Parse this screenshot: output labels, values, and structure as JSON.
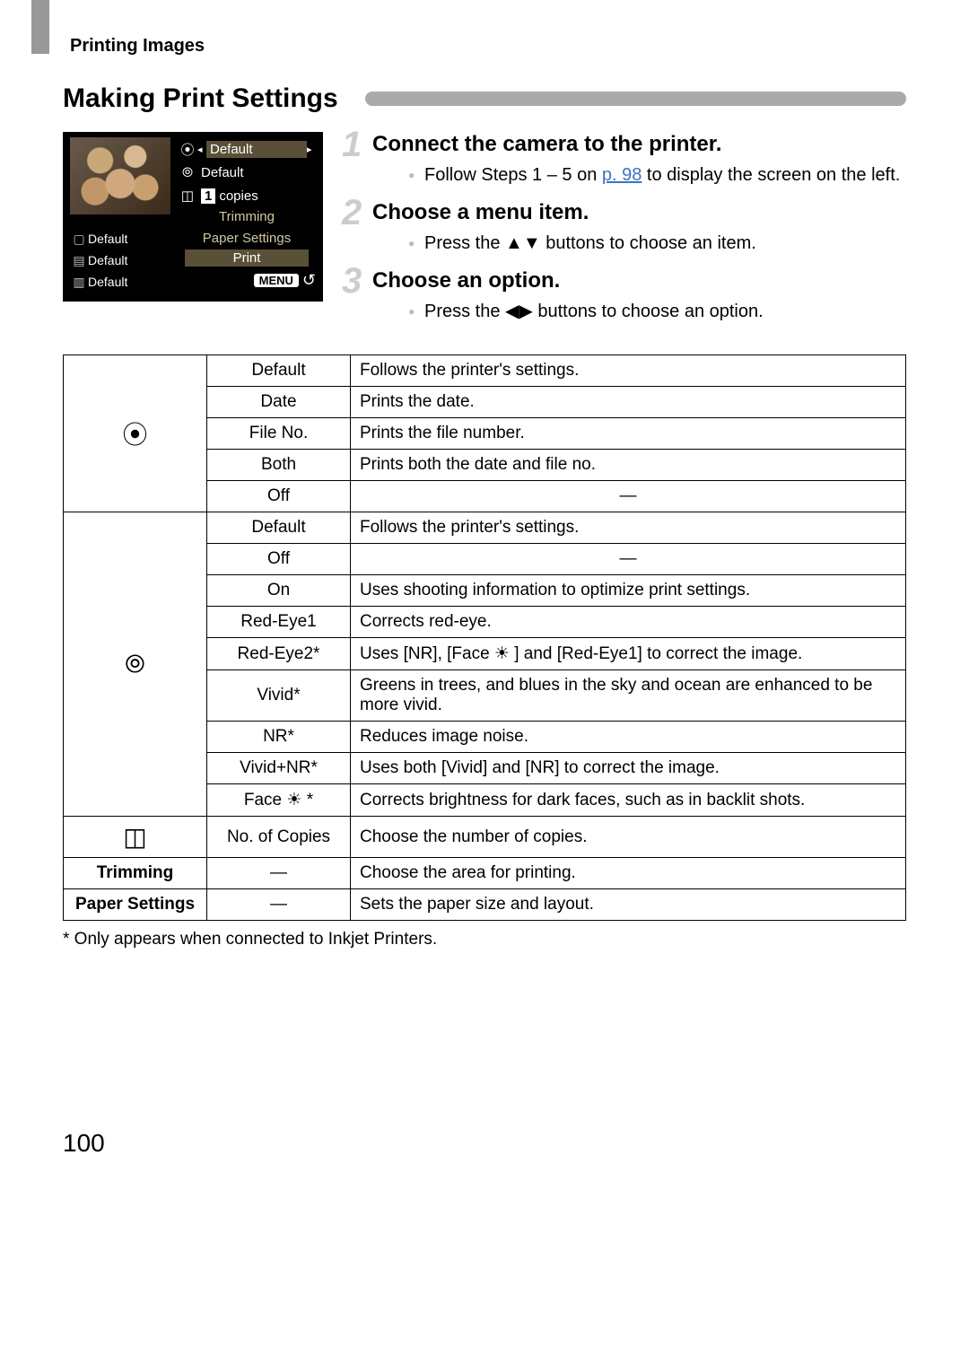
{
  "header": {
    "section": "Printing Images"
  },
  "title": "Making Print Settings",
  "screen": {
    "row1": {
      "icon": "⦿",
      "value": "Default"
    },
    "row2": {
      "icon": "⦾",
      "value": "Default"
    },
    "row3": {
      "icon": "◫",
      "num": "1",
      "suffix": "copies"
    },
    "trimming": "Trimming",
    "leftRows": [
      {
        "icon": "▢",
        "value": "Default"
      },
      {
        "icon": "▤",
        "value": "Default"
      },
      {
        "icon": "▥",
        "value": "Default"
      }
    ],
    "paperSettings": "Paper Settings",
    "print": "Print",
    "menu": "MENU",
    "back": "↺"
  },
  "steps": [
    {
      "num": "1",
      "title": "Connect the camera to the printer.",
      "body_pre": "Follow Steps 1 – 5 on ",
      "pageref": "p. 98",
      "body_post": " to display the screen on the left."
    },
    {
      "num": "2",
      "title": "Choose a menu item.",
      "body_pre": "Press the ",
      "arrows": "▲▼",
      "body_post": " buttons to choose an item."
    },
    {
      "num": "3",
      "title": "Choose an option.",
      "body_pre": "Press the ",
      "arrows": "◀▶",
      "body_post": " buttons to choose an option."
    }
  ],
  "table": {
    "groups": [
      {
        "catType": "icon",
        "catLabel": "⦿",
        "rows": [
          {
            "opt": "Default",
            "desc": "Follows the printer's settings."
          },
          {
            "opt": "Date",
            "desc": "Prints the date."
          },
          {
            "opt": "File No.",
            "desc": "Prints the file number."
          },
          {
            "opt": "Both",
            "desc": "Prints both the date and file no."
          },
          {
            "opt": "Off",
            "desc": "—",
            "center": true
          }
        ]
      },
      {
        "catType": "icon",
        "catLabel": "⦾",
        "rows": [
          {
            "opt": "Default",
            "desc": "Follows the printer's settings."
          },
          {
            "opt": "Off",
            "desc": "—",
            "center": true
          },
          {
            "opt": "On",
            "desc": "Uses shooting information to optimize print settings."
          },
          {
            "opt": "Red-Eye1",
            "desc": "Corrects red-eye."
          },
          {
            "opt": "Red-Eye2*",
            "desc": "Uses [NR], [Face ☀ ] and [Red-Eye1] to correct the image."
          },
          {
            "opt": "Vivid*",
            "desc": "Greens in trees, and blues in the sky and ocean are enhanced to be more vivid."
          },
          {
            "opt": "NR*",
            "desc": "Reduces image noise."
          },
          {
            "opt": "Vivid+NR*",
            "desc": "Uses both [Vivid] and [NR] to correct the image."
          },
          {
            "opt": "Face ☀ *",
            "desc": "Corrects brightness for dark faces, such as in backlit shots."
          }
        ]
      },
      {
        "catType": "icon",
        "catLabel": "◫",
        "rows": [
          {
            "opt": "No. of Copies",
            "desc": "Choose the number of copies."
          }
        ]
      },
      {
        "catType": "text",
        "catLabel": "Trimming",
        "rows": [
          {
            "opt": "—",
            "desc": "Choose the area for printing."
          }
        ]
      },
      {
        "catType": "text",
        "catLabel": "Paper Settings",
        "rows": [
          {
            "opt": "—",
            "desc": "Sets the paper size and layout."
          }
        ]
      }
    ]
  },
  "footnote": "*  Only appears when connected to Inkjet Printers.",
  "pageNumber": "100"
}
